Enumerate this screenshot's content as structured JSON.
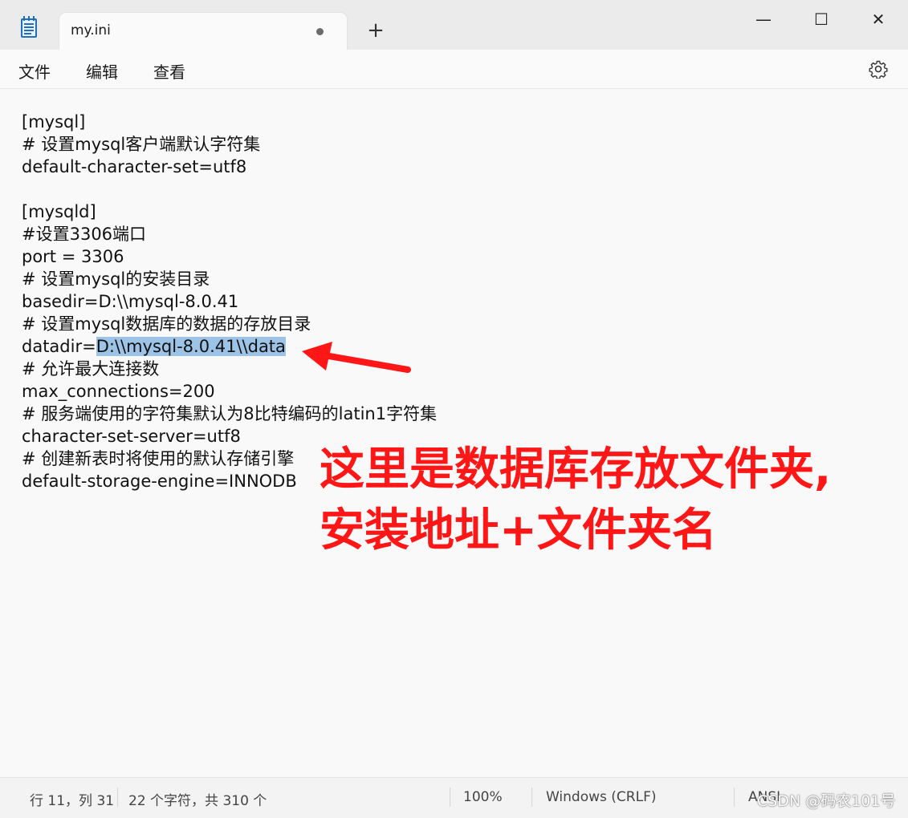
{
  "window": {
    "tab_title": "my.ini",
    "new_tab": "+",
    "minimize": "—",
    "maximize": "☐",
    "close": "✕"
  },
  "menu": {
    "file": "文件",
    "edit": "编辑",
    "view": "查看"
  },
  "editor": {
    "lines": [
      "[mysql]",
      "# 设置mysql客户端默认字符集",
      "default-character-set=utf8",
      "",
      "[mysqld]",
      "#设置3306端口",
      "port = 3306",
      "# 设置mysql的安装目录",
      "basedir=D:\\\\mysql-8.0.41",
      "# 设置mysql数据库的数据的存放目录",
      "datadir=",
      "# 允许最大连接数",
      "max_connections=200",
      "# 服务端使用的字符集默认为8比特编码的latin1字符集",
      "character-set-server=utf8",
      "# 创建新表时将使用的默认存储引擎",
      "default-storage-engine=INNODB"
    ],
    "selected_text": "D:\\\\mysql-8.0.41\\\\data"
  },
  "annotation": {
    "line1": "这里是数据库存放文件夹,",
    "line2": "安装地址+文件夹名",
    "color": "#ff1616"
  },
  "status": {
    "position": "行 11，列 31",
    "chars": "22 个字符，共 310 个",
    "zoom": "100%",
    "eol": "Windows (CRLF)",
    "encoding": "ANSI"
  },
  "watermark": "CSDN @码农101号",
  "icons": {
    "app": "notepad-icon",
    "settings": "gear-icon",
    "arrow": "red-arrow-icon"
  }
}
